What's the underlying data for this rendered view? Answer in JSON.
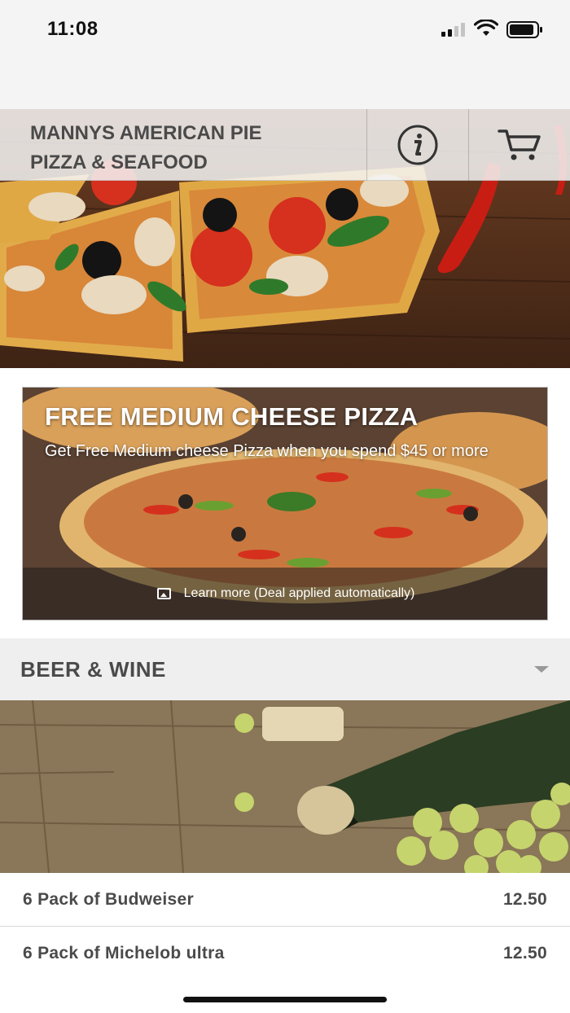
{
  "status_bar": {
    "time": "11:08"
  },
  "header": {
    "restaurant_name_line1": "MANNYS AMERICAN PIE",
    "restaurant_name_line2": "PIZZA & SEAFOOD",
    "info_icon": "info-icon",
    "cart_icon": "cart-icon"
  },
  "promo": {
    "title": "FREE MEDIUM CHEESE PIZZA",
    "description": "Get Free Medium cheese Pizza when you spend $45 or more",
    "learn_more": "Learn more (Deal applied automatically)"
  },
  "category": {
    "title": "BEER & WINE",
    "expand_icon": "chevron-down-icon"
  },
  "menu_items": [
    {
      "name": "6 Pack of Budweiser",
      "price": "12.50"
    },
    {
      "name": "6 Pack of Michelob ultra",
      "price": "12.50"
    }
  ],
  "colors": {
    "header_bg": "#f4f4f4",
    "text_dark": "#4a4a4a",
    "category_bg": "#efefef"
  }
}
